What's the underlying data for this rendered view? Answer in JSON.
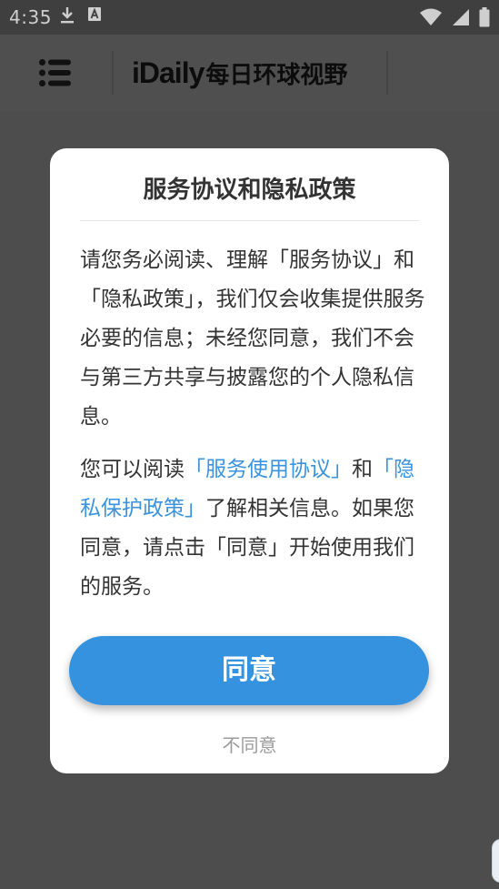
{
  "status_bar": {
    "time": "4:35",
    "left_icons": [
      "download-icon",
      "a-icon"
    ],
    "right_icons": [
      "wifi-icon",
      "signal-icon",
      "battery-icon"
    ]
  },
  "app_bar": {
    "logo_latin": "iDaily",
    "logo_cjk": "每日环球视野"
  },
  "dialog": {
    "title": "服务协议和隐私政策",
    "paragraph1": "请您务必阅读、理解「服务协议」和「隐私政策」，我们仅会收集提供服务必要的信息；未经您同意，我们不会与第三方共享与披露您的个人隐私信息。",
    "paragraph2": {
      "part1": "您可以阅读",
      "link_service": "「服务使用协议」",
      "part2": "和",
      "link_privacy": "「隐私保护政策」",
      "part3": "了解相关信息。如果您同意，请点击「同意」开始使用我们的服务。"
    },
    "agree_label": "同意",
    "disagree_label": "不同意"
  },
  "colors": {
    "overlay": "#4d4d4d",
    "accent": "#3592df",
    "link": "#3b93de",
    "text": "#333333",
    "muted": "#9b9b9b"
  }
}
